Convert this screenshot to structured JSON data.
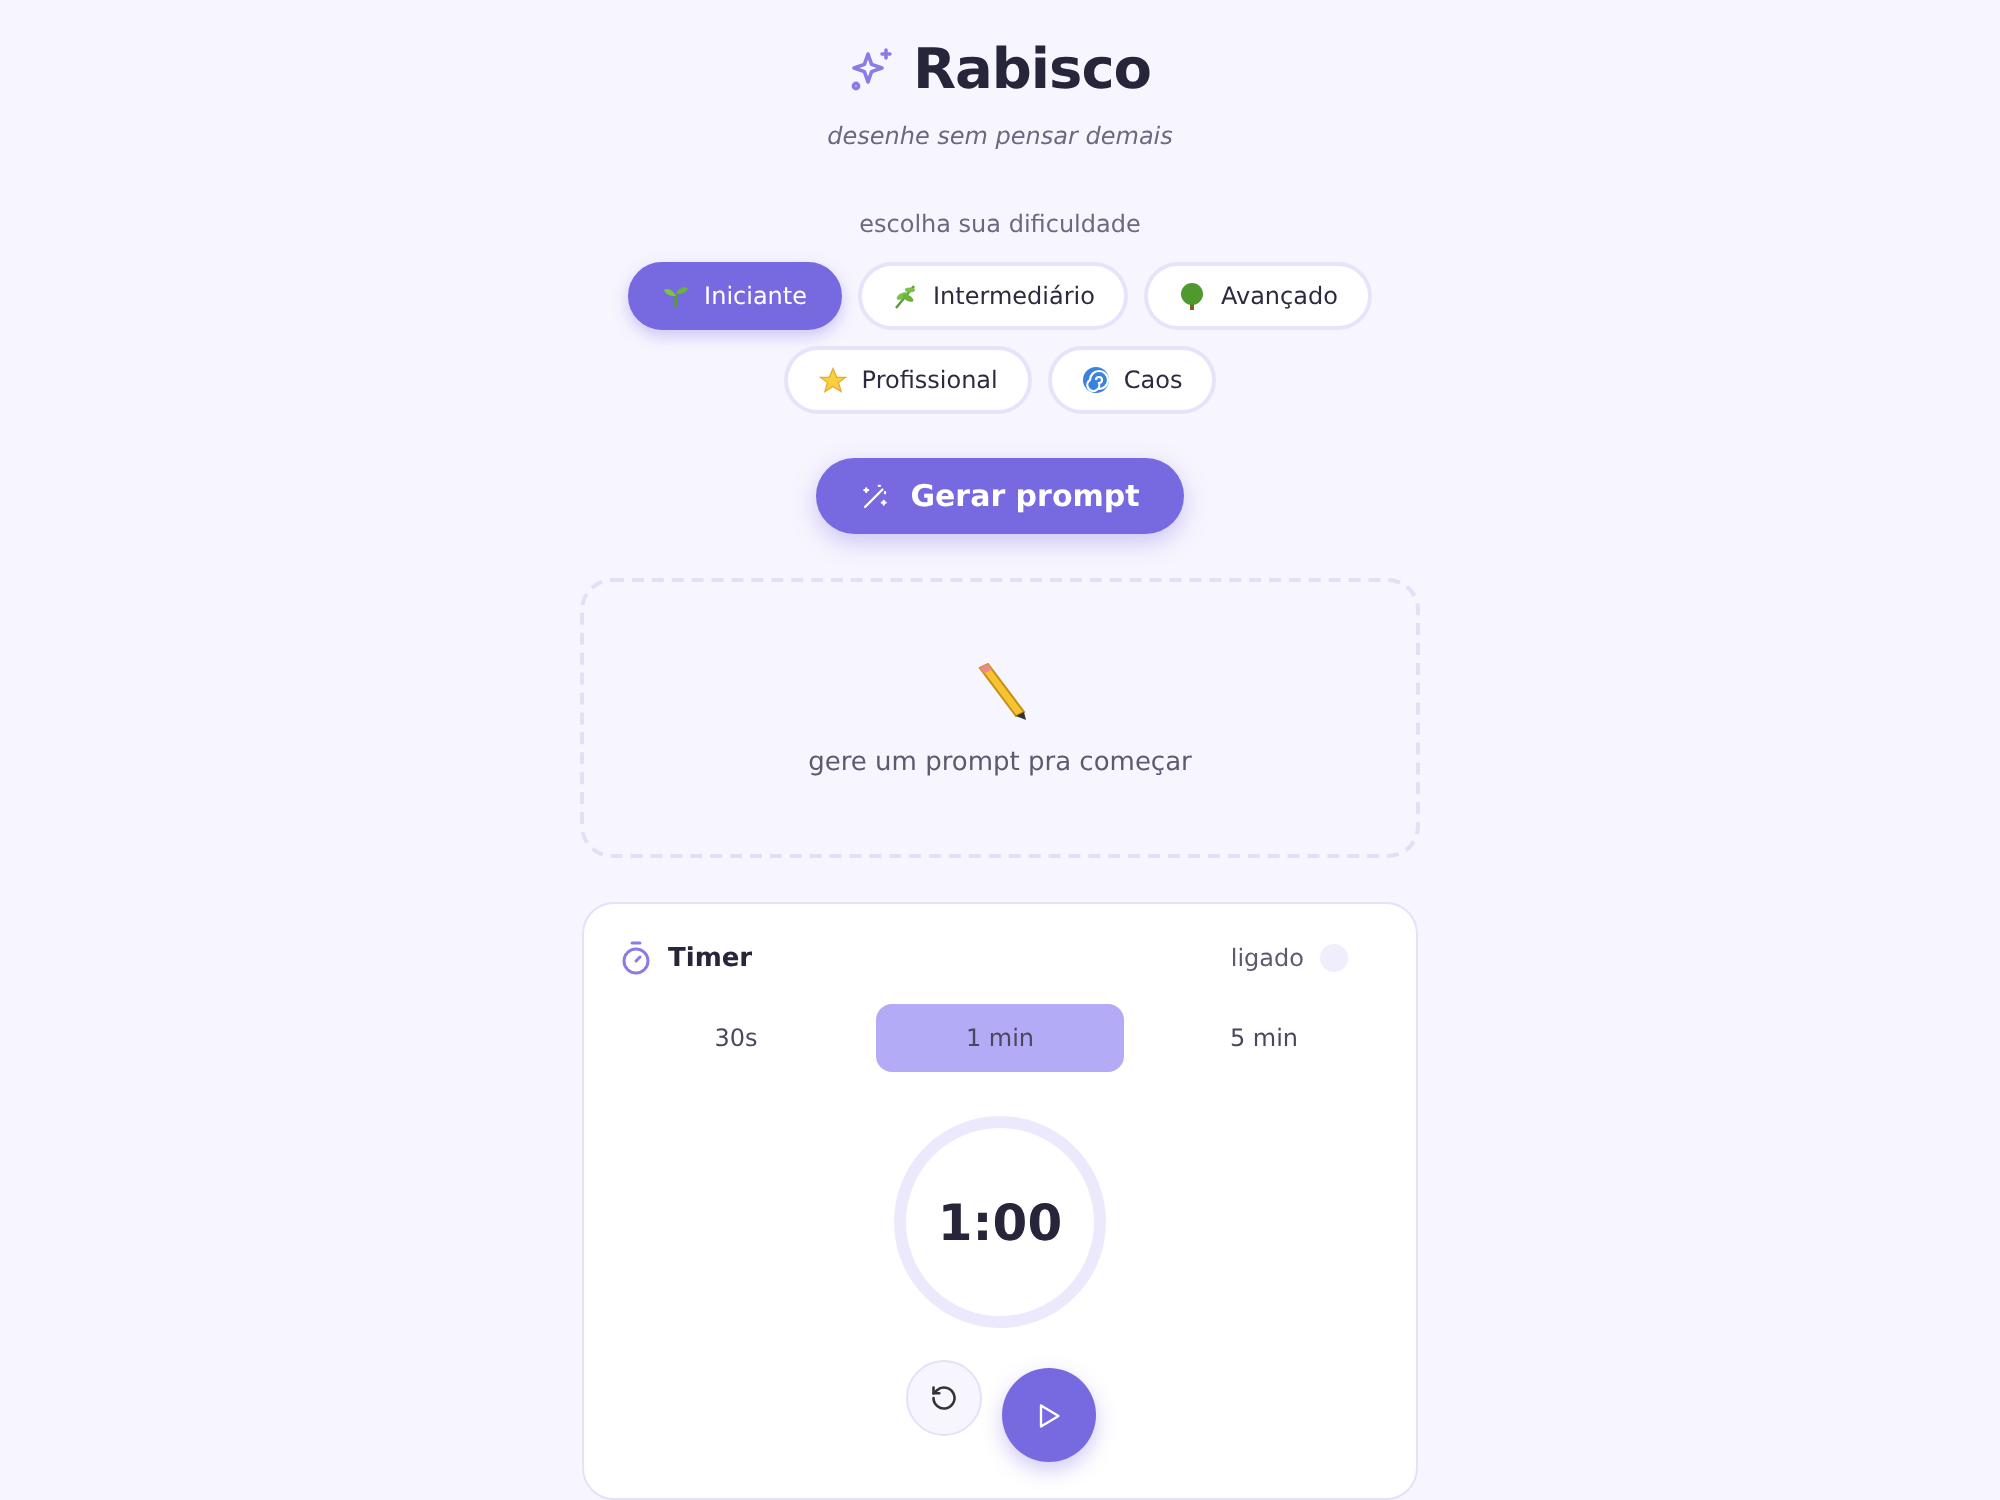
{
  "app": {
    "title": "Rabisco",
    "tagline": "desenhe sem pensar demais"
  },
  "difficulty": {
    "label": "escolha sua dificuldade",
    "levels": [
      {
        "label": "Iniciante",
        "selected": true
      },
      {
        "label": "Intermediário",
        "selected": false
      },
      {
        "label": "Avançado",
        "selected": false
      },
      {
        "label": "Profissional",
        "selected": false
      },
      {
        "label": "Caos",
        "selected": false
      }
    ]
  },
  "generate_button": {
    "label": "Gerar prompt"
  },
  "prompt_placeholder": {
    "text": "gere um prompt pra começar"
  },
  "timer": {
    "title": "Timer",
    "toggle": {
      "label": "ligado",
      "on": false
    },
    "durations": [
      {
        "label": "30s",
        "selected": false
      },
      {
        "label": "1 min",
        "selected": true
      },
      {
        "label": "5 min",
        "selected": false
      }
    ],
    "display": "1:00"
  }
}
